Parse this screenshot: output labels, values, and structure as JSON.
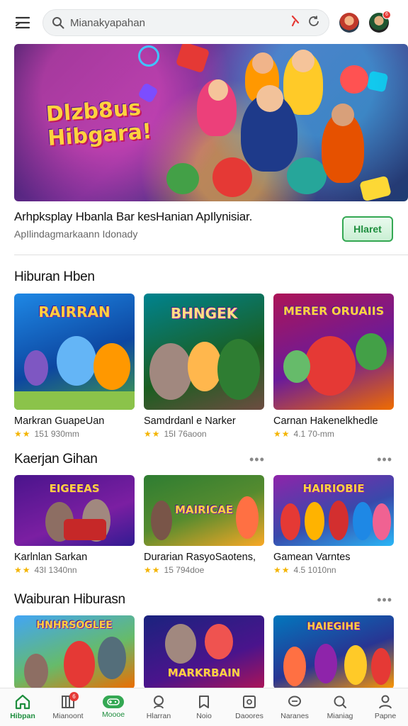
{
  "search": {
    "placeholder": "Mianakyapahan"
  },
  "hero": {
    "title_line1": "Dlzb8us",
    "title_line2": "Hibgara!"
  },
  "app": {
    "title": "Arhpksplay Hbanla Bar kesHanian ApIlynisiar.",
    "subtitle": "ApIlindagmarkaann Idonady",
    "cta_label": "Hlaret"
  },
  "sections": [
    {
      "title": "Hiburan Hben",
      "cards": [
        {
          "name": "Markran GuapeUan",
          "meta": "151 930mm",
          "art_label": "RAIRRAN",
          "colors": [
            "#2e7dd1",
            "#f6a623"
          ]
        },
        {
          "name": "Samdrdanl e Narker",
          "meta": "15I 76aoon",
          "art_label": "BHNGEK",
          "colors": [
            "#1b7f8c",
            "#7cb342"
          ]
        },
        {
          "name": "Carnan Hakenelkhedle",
          "meta": "4.1 70-mm",
          "art_label": "MERER ORUAIIS",
          "colors": [
            "#c2185b",
            "#ff7043"
          ]
        }
      ]
    },
    {
      "title": "Kaerjan Gihan",
      "cards": [
        {
          "name": "Karlnlan Sarkan",
          "meta": "43I 1340nn",
          "art_label": "EIGEEAS",
          "colors": [
            "#4a148c",
            "#8e24aa"
          ]
        },
        {
          "name": "Durarian RasyoSaotens,",
          "meta": "15 794doe",
          "art_label": "MAIRICAE",
          "colors": [
            "#2e7d32",
            "#f9a825"
          ]
        },
        {
          "name": "Gamean Varntes",
          "meta": "4.5 1010nn",
          "art_label": "HAIRIOBIE",
          "colors": [
            "#6a1b9a",
            "#29b6f6"
          ]
        }
      ]
    },
    {
      "title": "Waiburan Hiburasn",
      "cards": [
        {
          "name": "",
          "meta": "",
          "art_label": "HNHRSOGLEE",
          "colors": [
            "#66bb6a",
            "#1e88e5"
          ]
        },
        {
          "name": "",
          "meta": "",
          "art_label": "MARKRBAIN",
          "colors": [
            "#283593",
            "#ab47bc"
          ]
        },
        {
          "name": "",
          "meta": "",
          "art_label": "HAIEGIHE",
          "colors": [
            "#0277bd",
            "#ff9800"
          ]
        }
      ]
    }
  ],
  "nav": [
    {
      "label": "Hibpan",
      "icon": "home-icon",
      "active": true,
      "badge": ""
    },
    {
      "label": "Mianoont",
      "icon": "library-icon",
      "active": false,
      "badge": "6"
    },
    {
      "label": "Moooe",
      "icon": "controller-icon",
      "active": false,
      "badge": ""
    },
    {
      "label": "Hlarran",
      "icon": "explore-icon",
      "active": false,
      "badge": ""
    },
    {
      "label": "Noio",
      "icon": "bookmark-icon",
      "active": false,
      "badge": ""
    },
    {
      "label": "Daoores",
      "icon": "puzzle-icon",
      "active": false,
      "badge": ""
    },
    {
      "label": "Naranes",
      "icon": "chat-icon",
      "active": false,
      "badge": ""
    },
    {
      "label": "Mianiag",
      "icon": "search-icon",
      "active": false,
      "badge": ""
    },
    {
      "label": "Papne",
      "icon": "profile-icon",
      "active": false,
      "badge": ""
    }
  ],
  "notif_badge": "6"
}
